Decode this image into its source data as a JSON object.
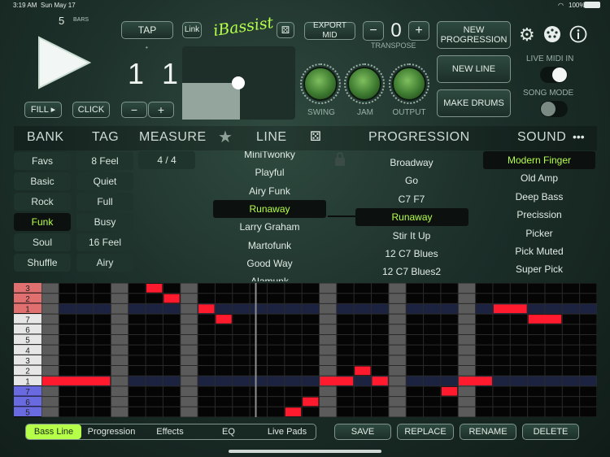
{
  "status": {
    "time": "3:19 AM",
    "date": "Sun May 17",
    "battery": "100%"
  },
  "top": {
    "bars_count": "5",
    "bars_label": "BARS",
    "tap": "TAP",
    "link": "Link",
    "logo": "iBassist",
    "export": "EXPORT MID",
    "transpose_minus": "−",
    "transpose_value": "0",
    "transpose_plus": "+",
    "transpose_label": "TRANSPOSE",
    "new_progression": "NEW PROGRESSION",
    "new_line": "NEW LINE",
    "make_drums": "MAKE DRUMS",
    "counter": "1 1 1",
    "dot": "•",
    "fill": "FILL ▸",
    "click": "CLICK",
    "tempo_minus": "−",
    "tempo_plus": "+",
    "knob_swing": "SWING",
    "knob_jam": "JAM",
    "knob_output": "OUTPUT",
    "live_midi": "LIVE MIDI IN",
    "song_mode": "SONG MODE"
  },
  "headers": {
    "bank": "BANK",
    "tag": "TAG",
    "measure": "MEASURE",
    "line": "LINE",
    "progression": "PROGRESSION",
    "sound": "SOUND",
    "more": "•••"
  },
  "bank": [
    "Favs",
    "Basic",
    "Rock",
    "Funk",
    "Soul",
    "Shuffle"
  ],
  "bank_selected": 3,
  "tag": [
    "8 Feel",
    "Quiet",
    "Full",
    "Busy",
    "16 Feel",
    "Airy"
  ],
  "measure": "4 / 4",
  "lines": [
    "MiniTwonky",
    "Playful",
    "Airy Funk",
    "Runaway",
    "Larry Graham",
    "Martofunk",
    "Good Way",
    "Alamunk"
  ],
  "line_selected": 3,
  "progressions": [
    "Broadway",
    "Go",
    "C7 F7",
    "Runaway",
    "Stir It Up",
    "12 C7 Blues",
    "12 C7 Blues2"
  ],
  "progression_selected": 3,
  "sounds": [
    "Modern Finger",
    "Old Amp",
    "Deep Bass",
    "Precission",
    "Picker",
    "Pick Muted",
    "Super Pick"
  ],
  "sound_selected": 0,
  "roll": {
    "labels": [
      "3",
      "2",
      "1",
      "7",
      "6",
      "5",
      "4",
      "3",
      "2",
      "1",
      "7",
      "6",
      "5"
    ],
    "colors": {
      "upper": "#e07070",
      "middle": "#e6e6e6",
      "lower": "#6a6ae0",
      "note": "#ff1a2e"
    }
  },
  "tabs": [
    "Bass Line",
    "Progression",
    "Effects",
    "EQ",
    "Live Pads"
  ],
  "tab_selected": 0,
  "actions": {
    "save": "SAVE",
    "replace": "REPLACE",
    "rename": "RENAME",
    "delete": "DELETE"
  },
  "accent": "#b5ff4a"
}
